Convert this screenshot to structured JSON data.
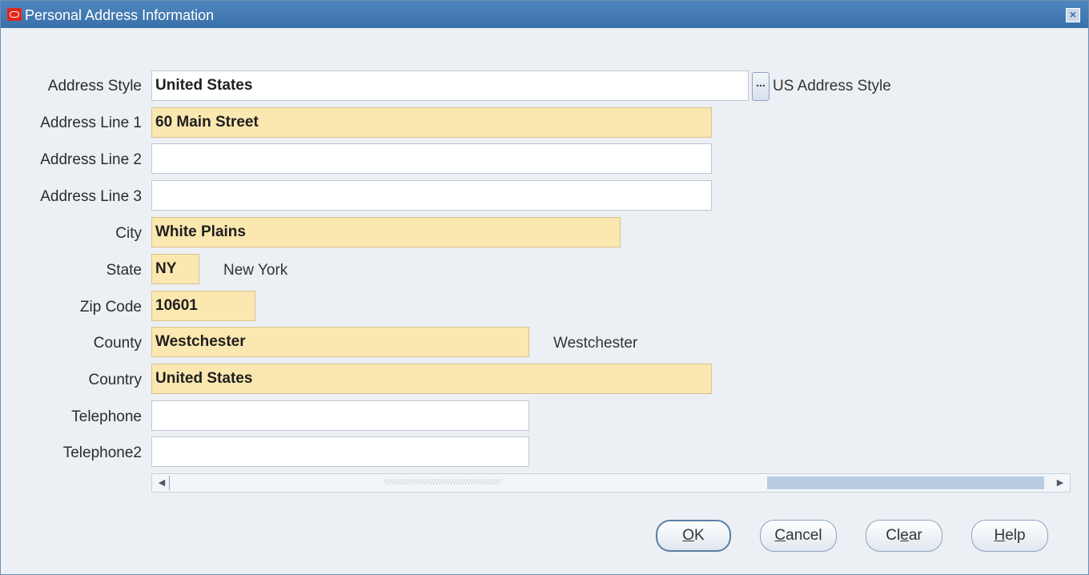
{
  "window": {
    "title": "Personal Address Information",
    "close_label": "×"
  },
  "fields": {
    "address_style": {
      "label": "Address Style",
      "value": "United States",
      "lov_label": "...",
      "description": "US Address Style"
    },
    "address_line_1": {
      "label": "Address Line 1",
      "value": "60 Main Street"
    },
    "address_line_2": {
      "label": "Address Line 2",
      "value": ""
    },
    "address_line_3": {
      "label": "Address Line 3",
      "value": ""
    },
    "city": {
      "label": "City",
      "value": "White Plains"
    },
    "state": {
      "label": "State",
      "value": "NY",
      "description": "New York"
    },
    "zip_code": {
      "label": "Zip Code",
      "value": "10601"
    },
    "county": {
      "label": "County",
      "value": "Westchester",
      "description": "Westchester"
    },
    "country": {
      "label": "Country",
      "value": "United States"
    },
    "telephone": {
      "label": "Telephone",
      "value": ""
    },
    "telephone2": {
      "label": "Telephone2",
      "value": ""
    }
  },
  "scrollbar": {
    "left_arrow": "◀",
    "right_arrow": "▶",
    "grip": "⁄⁄⁄⁄⁄⁄⁄⁄⁄⁄⁄⁄⁄⁄⁄⁄⁄⁄⁄⁄⁄⁄⁄⁄⁄⁄⁄⁄⁄⁄⁄⁄⁄⁄⁄⁄⁄⁄⁄⁄"
  },
  "buttons": {
    "ok": {
      "mnemonic": "O",
      "rest": "K"
    },
    "cancel": {
      "mnemonic": "C",
      "rest": "ancel"
    },
    "clear": {
      "pre": "Cl",
      "mnemonic": "e",
      "rest": "ar"
    },
    "help": {
      "mnemonic": "H",
      "rest": "elp"
    }
  },
  "colors": {
    "title_bar": "#3a70aa",
    "required_field": "#fbe7b0",
    "window_bg": "#ecf0f4"
  }
}
